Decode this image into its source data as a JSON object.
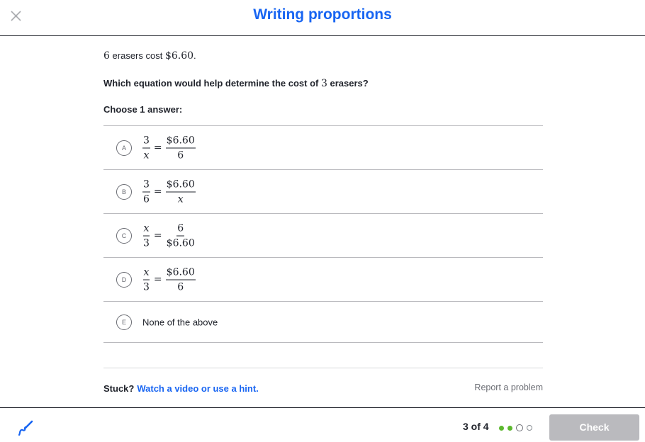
{
  "header": {
    "title": "Writing proportions"
  },
  "problem": {
    "statement_count": "6",
    "statement_text": " erasers cost ",
    "statement_price": "$6.60",
    "statement_end": ".",
    "question_pre": "Which equation would help determine the cost of ",
    "question_count": "3",
    "question_post": " erasers?",
    "choose_label": "Choose 1 answer:"
  },
  "choices": [
    {
      "letter": "A",
      "left_num": "3",
      "left_den": "x",
      "equals": "=",
      "right_num": "$6.60",
      "right_den": "6"
    },
    {
      "letter": "B",
      "left_num": "3",
      "left_den": "6",
      "equals": "=",
      "right_num": "$6.60",
      "right_den": "x"
    },
    {
      "letter": "C",
      "left_num": "x",
      "left_den": "3",
      "equals": "=",
      "right_num": "6",
      "right_den": "$6.60"
    },
    {
      "letter": "D",
      "left_num": "x",
      "left_den": "3",
      "equals": "=",
      "right_num": "$6.60",
      "right_den": "6"
    },
    {
      "letter": "E",
      "text": "None of the above"
    }
  ],
  "help": {
    "stuck_label": "Stuck?",
    "hint_link": "Watch a video or use a hint.",
    "report_link": "Report a problem"
  },
  "footer": {
    "progress": "3 of 4",
    "progress_done": 2,
    "progress_total": 4,
    "check_label": "Check"
  },
  "colors": {
    "accent": "#1865f2",
    "done_dot": "#5cb82e",
    "check_disabled": "#bababe"
  },
  "icons": {
    "close": "close-icon",
    "scratchpad": "scratchpad-pencil-icon"
  }
}
